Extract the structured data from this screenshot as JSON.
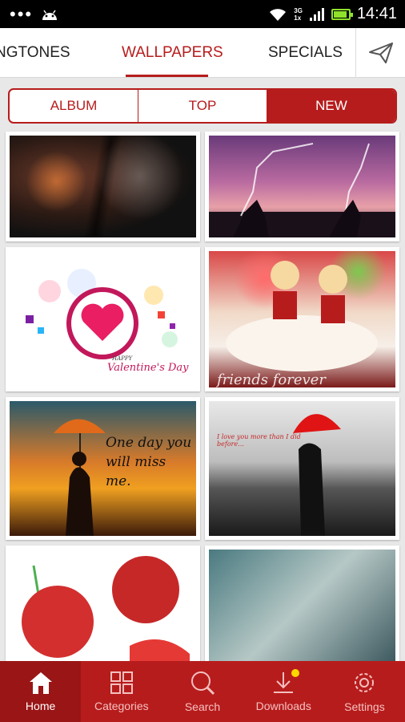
{
  "status_bar": {
    "time": "14:41",
    "network_top": "3G",
    "network_bottom": "1x",
    "battery_level": 0.9,
    "icons": [
      "overflow-dots-icon",
      "android-icon",
      "wifi-icon",
      "signal-icon",
      "battery-icon"
    ]
  },
  "tabs": [
    {
      "label": "NGTONES",
      "active": false
    },
    {
      "label": "WALLPAPERS",
      "active": true
    },
    {
      "label": "SPECIALS",
      "active": false
    }
  ],
  "send_icon": "paper-plane-icon",
  "segments": [
    {
      "label": "ALBUM",
      "active": false
    },
    {
      "label": "TOP",
      "active": false
    },
    {
      "label": "NEW",
      "active": true
    }
  ],
  "wallpapers": [
    {
      "subject": "dark faces"
    },
    {
      "subject": "silhouettes lightning"
    },
    {
      "subject": "valentine heart",
      "caption_small": "HAPPY",
      "caption": "Valentine's Day"
    },
    {
      "subject": "dolls on cake",
      "caption": "friends forever"
    },
    {
      "subject": "girl with umbrella",
      "caption": "One day you will miss me."
    },
    {
      "subject": "couple red umbrella",
      "caption": "I love you more than I did before..."
    },
    {
      "subject": "red roses"
    },
    {
      "subject": "kiss sketch"
    }
  ],
  "bottom_nav": [
    {
      "label": "Home",
      "icon": "home-icon",
      "active": true
    },
    {
      "label": "Categories",
      "icon": "grid-icon",
      "active": false
    },
    {
      "label": "Search",
      "icon": "search-icon",
      "active": false
    },
    {
      "label": "Downloads",
      "icon": "download-icon",
      "active": false,
      "badge": true
    },
    {
      "label": "Settings",
      "icon": "gear-icon",
      "active": false
    }
  ],
  "colors": {
    "accent": "#b71c1c",
    "accent_dark": "#9a1515",
    "badge": "#ffd700"
  }
}
